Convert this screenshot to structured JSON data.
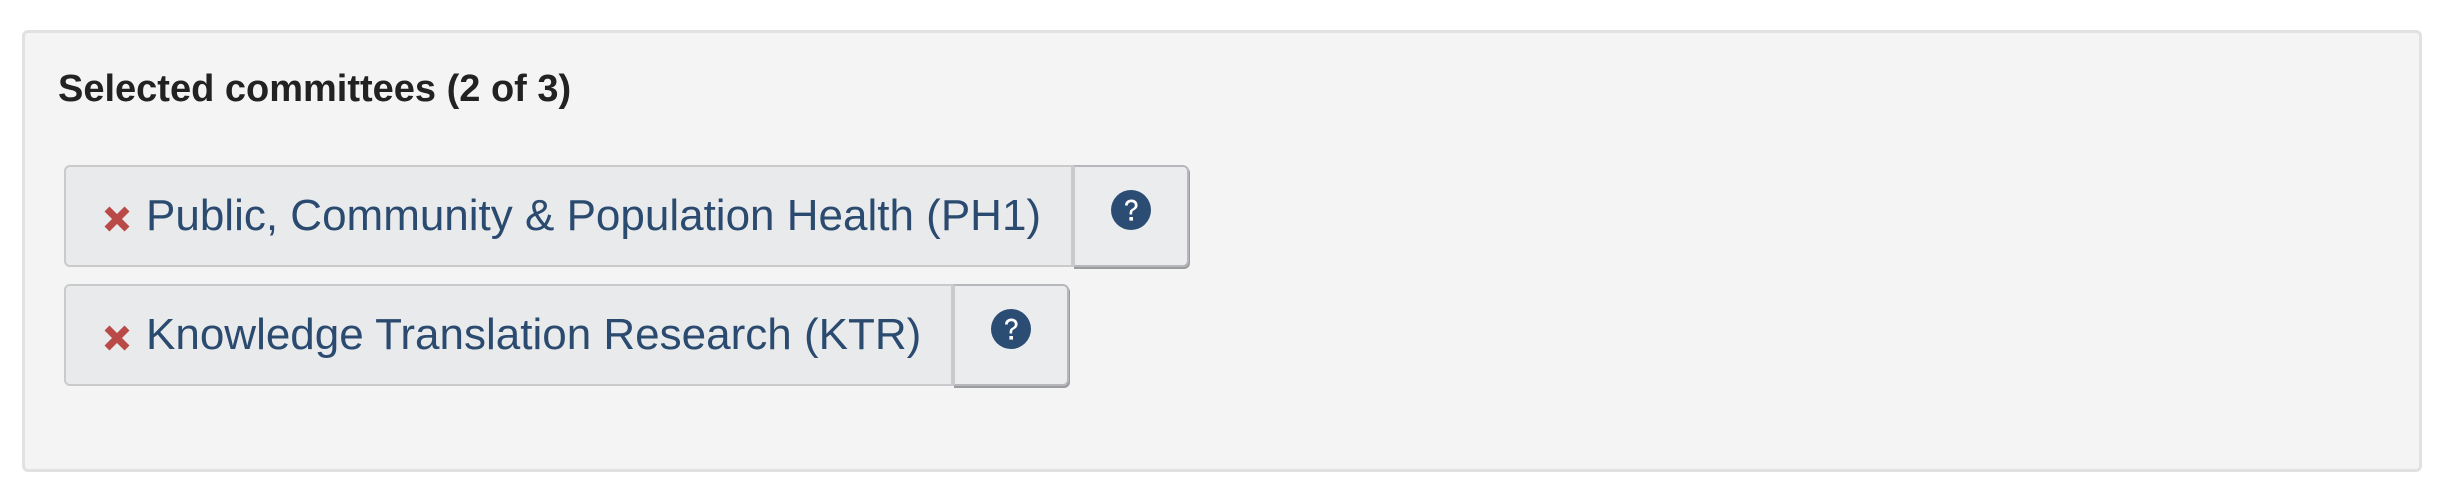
{
  "panel": {
    "heading": "Selected committees (2 of 3)"
  },
  "committees": [
    {
      "label": "Public, Community & Population Health (PH1)",
      "remove_icon": "times-icon",
      "help_icon": "question-circle-icon"
    },
    {
      "label": "Knowledge Translation Research (KTR)",
      "remove_icon": "times-icon",
      "help_icon": "question-circle-icon"
    }
  ],
  "colors": {
    "panel_background": "#f4f4f4",
    "chip_background": "#e9eaeb",
    "label_text": "#2a4a6f",
    "remove_icon": "#b94a48",
    "help_icon": "#2b4c73"
  }
}
